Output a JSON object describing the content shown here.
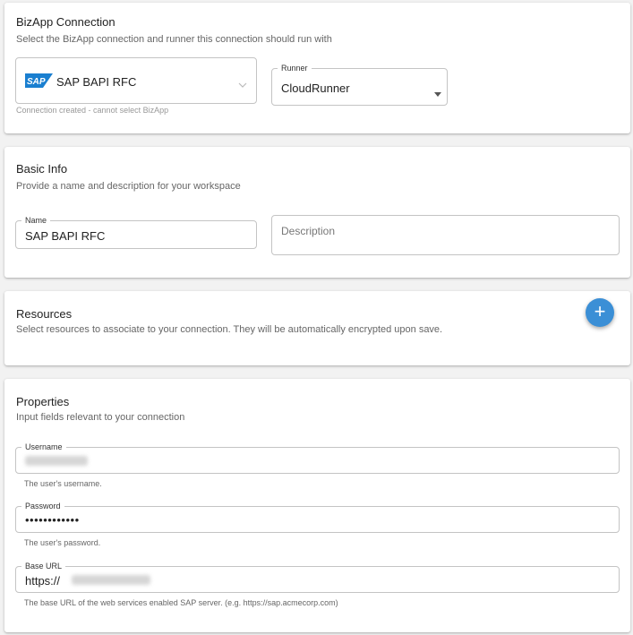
{
  "bizapp": {
    "title": "BizApp Connection",
    "subtitle": "Select the BizApp connection and runner this connection should run with",
    "connection_logo_text": "SAP",
    "connection_value": "SAP BAPI RFC",
    "connection_helper": "Connection created - cannot select BizApp",
    "runner_label": "Runner",
    "runner_value": "CloudRunner",
    "brand_color": "#1a7fd0"
  },
  "basic_info": {
    "title": "Basic Info",
    "subtitle": "Provide a name and description for your workspace",
    "name_label": "Name",
    "name_value": "SAP BAPI RFC",
    "description_placeholder": "Description"
  },
  "resources": {
    "title": "Resources",
    "subtitle": "Select resources to associate to your connection. They will be automatically encrypted upon save.",
    "add_label": "+"
  },
  "properties": {
    "title": "Properties",
    "subtitle": "Input fields relevant to your connection",
    "username_label": "Username",
    "username_helper": "The user's username.",
    "password_label": "Password",
    "password_value": "••••••••••••",
    "password_helper": "The user's password.",
    "baseurl_label": "Base URL",
    "baseurl_value": "https://",
    "baseurl_helper": "The base URL of the web services enabled SAP server. (e.g. https://sap.acmecorp.com)"
  }
}
